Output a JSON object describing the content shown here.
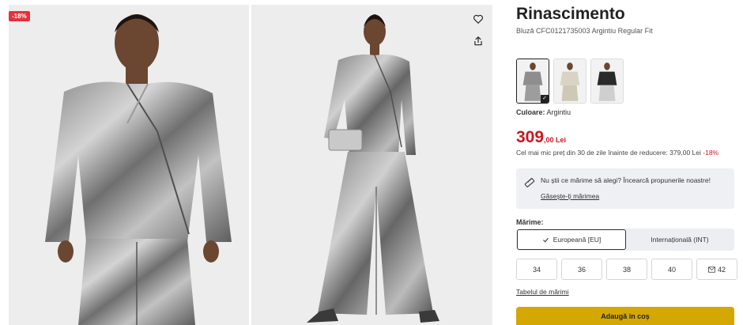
{
  "gallery": {
    "discount_badge": "-18%",
    "icons": {
      "wishlist": "heart-icon",
      "share": "share-icon"
    }
  },
  "product": {
    "brand": "Rinascimento",
    "subtitle": "Bluză CFC0121735003 Argintiu Regular Fit",
    "color_label": "Culoare:",
    "color_value": "Argintiu",
    "price_main": "309",
    "price_decimals": ",00 Lei",
    "lowest_price_text": "Cel mai mic preț din 30 de zile înainte de reducere: 379,00 Lei",
    "lowest_price_discount": "-18%",
    "variants": [
      "silver",
      "champagne",
      "black"
    ]
  },
  "size_advisor": {
    "text": "Nu știi ce mărime să alegi? Încearcă propunerile noastre!",
    "link": "Găsește-ți mărimea"
  },
  "sizes": {
    "label": "Mărime:",
    "toggle": [
      {
        "label": "Europeană [EU]",
        "selected": true
      },
      {
        "label": "Internațională (INT)",
        "selected": false
      }
    ],
    "options": [
      "34",
      "36",
      "38",
      "40",
      "42"
    ],
    "size_table_link": "Tabelul de mărimi"
  },
  "cart": {
    "add_label": "Adaugă în coș"
  },
  "colors": {
    "accent_red": "#c8191f",
    "badge_red": "#e4323c",
    "cart_yellow": "#d5a703"
  }
}
